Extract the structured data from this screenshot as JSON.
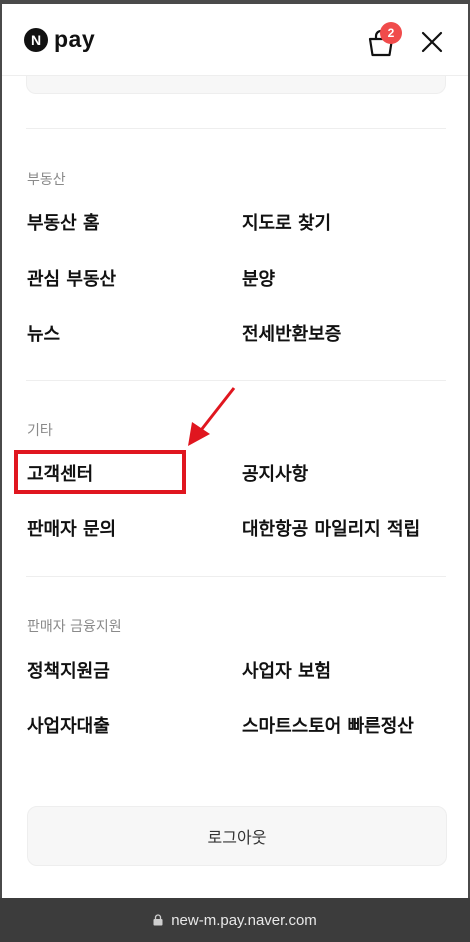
{
  "header": {
    "logo_badge": "N",
    "logo_text": "pay",
    "cart_count": "2"
  },
  "sections": {
    "real_estate": {
      "title": "부동산",
      "items": [
        "부동산 홈",
        "지도로 찾기",
        "관심 부동산",
        "분양",
        "뉴스",
        "전세반환보증"
      ]
    },
    "etc": {
      "title": "기타",
      "items": [
        "고객센터",
        "공지사항",
        "판매자 문의",
        "대한항공 마일리지 적립"
      ]
    },
    "seller_finance": {
      "title": "판매자 금융지원",
      "items": [
        "정책지원금",
        "사업자 보험",
        "사업자대출",
        "스마트스토어 빠른정산"
      ]
    }
  },
  "logout_label": "로그아웃",
  "browser": {
    "url": "new-m.pay.naver.com"
  },
  "colors": {
    "highlight": "#e0161f",
    "badge": "#f04b4b"
  }
}
